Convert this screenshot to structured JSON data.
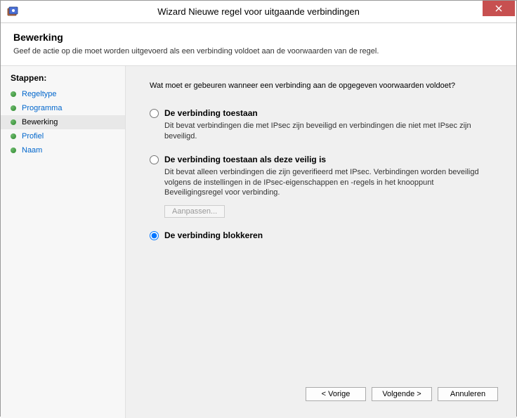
{
  "titlebar": {
    "title": "Wizard Nieuwe regel voor uitgaande verbindingen"
  },
  "header": {
    "title": "Bewerking",
    "description": "Geef de actie op die moet worden uitgevoerd als een verbinding voldoet aan de voorwaarden van de regel."
  },
  "sidebar": {
    "heading": "Stappen:",
    "steps": [
      {
        "label": "Regeltype",
        "current": false
      },
      {
        "label": "Programma",
        "current": false
      },
      {
        "label": "Bewerking",
        "current": true
      },
      {
        "label": "Profiel",
        "current": false
      },
      {
        "label": "Naam",
        "current": false
      }
    ]
  },
  "content": {
    "question": "Wat moet er gebeuren wanneer een verbinding aan de opgegeven voorwaarden voldoet?",
    "options": [
      {
        "id": "allow",
        "title": "De verbinding toestaan",
        "description": "Dit bevat verbindingen die met IPsec zijn beveiligd en verbindingen die niet met IPsec zijn beveiligd.",
        "selected": false,
        "has_customize": false
      },
      {
        "id": "allow-secure",
        "title": "De verbinding toestaan als deze veilig is",
        "description": "Dit bevat alleen verbindingen die zijn geverifieerd met IPsec. Verbindingen worden beveiligd volgens de instellingen in de IPsec-eigenschappen en -regels in het knooppunt Beveiligingsregel voor verbinding.",
        "selected": false,
        "has_customize": true,
        "customize_label": "Aanpassen..."
      },
      {
        "id": "block",
        "title": "De verbinding blokkeren",
        "description": "",
        "selected": true,
        "has_customize": false
      }
    ]
  },
  "buttons": {
    "back": "< Vorige",
    "next": "Volgende >",
    "cancel": "Annuleren"
  }
}
